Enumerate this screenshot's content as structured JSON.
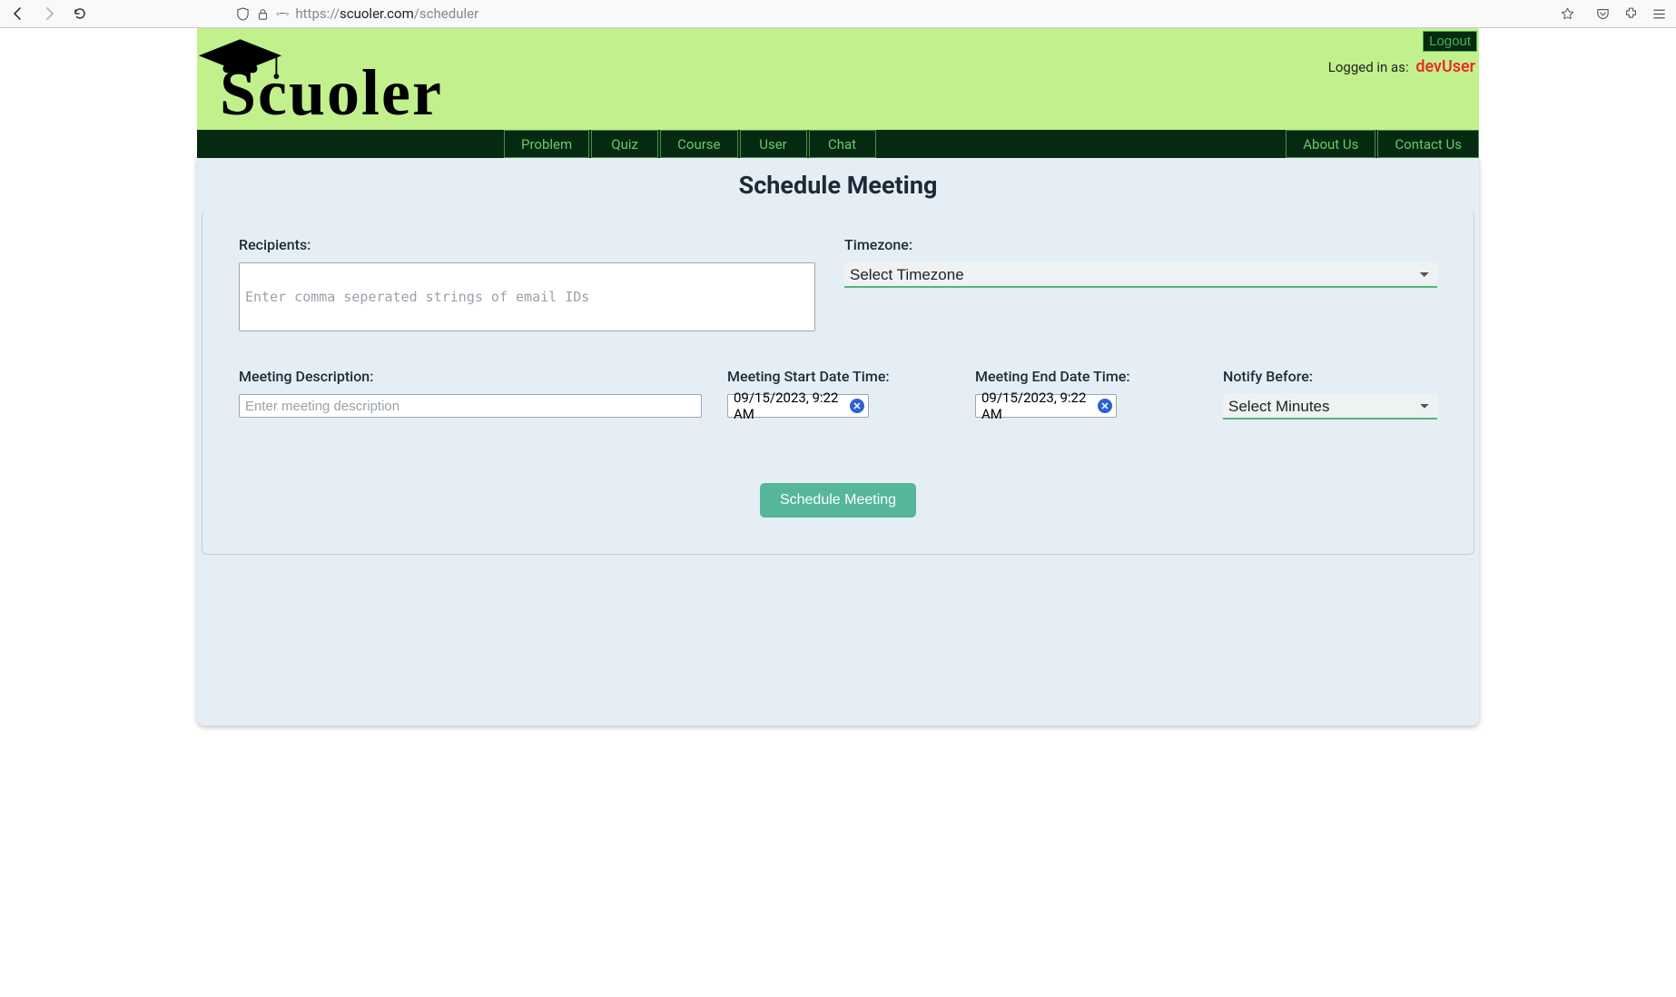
{
  "browser": {
    "url_prefix": "https://",
    "url_domain": "scuoler.com",
    "url_path": "/scheduler"
  },
  "header": {
    "brand": "Scuoler",
    "logout": "Logout",
    "logged_in_label": "Logged in as:",
    "user": "devUser"
  },
  "nav": {
    "left": [
      "Problem",
      "Quiz",
      "Course",
      "User",
      "Chat"
    ],
    "right": [
      "About Us",
      "Contact Us"
    ]
  },
  "page": {
    "title": "Schedule Meeting"
  },
  "form": {
    "recipients_label": "Recipients:",
    "recipients_placeholder": "Enter comma seperated strings of email IDs",
    "timezone_label": "Timezone:",
    "timezone_value": "Select Timezone",
    "description_label": "Meeting Description:",
    "description_placeholder": "Enter meeting description",
    "start_label": "Meeting Start Date Time:",
    "start_value": "09/15/2023, 9:22 AM",
    "end_label": "Meeting End Date Time:",
    "end_value": "09/15/2023, 9:22 AM",
    "notify_label": "Notify Before:",
    "notify_value": "Select Minutes",
    "submit": "Schedule Meeting"
  }
}
